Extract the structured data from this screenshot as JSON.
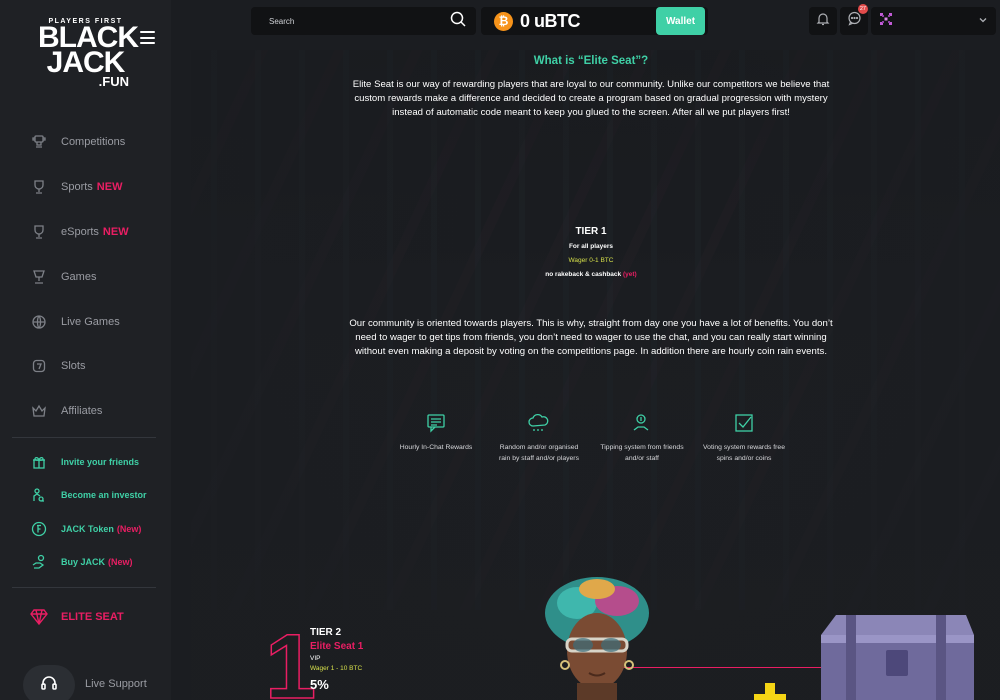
{
  "sidebar": {
    "logo": {
      "tagline": "PLAYERS FIRST",
      "line1": "BLACK",
      "line2": "JACK",
      "line3": ".FUN"
    },
    "nav": [
      {
        "label": "Competitions",
        "new": ""
      },
      {
        "label": "Sports",
        "new": "NEW"
      },
      {
        "label": "eSports",
        "new": "NEW"
      },
      {
        "label": "Games",
        "new": ""
      },
      {
        "label": "Live Games",
        "new": ""
      },
      {
        "label": "Slots",
        "new": ""
      },
      {
        "label": "Affiliates",
        "new": ""
      }
    ],
    "promo": [
      {
        "label": "Invite your friends",
        "new": ""
      },
      {
        "label": "Become an investor",
        "new": ""
      },
      {
        "label": "JACK Token",
        "new": "(New)"
      },
      {
        "label": "Buy JACK",
        "new": "(New)"
      }
    ],
    "elite_label": "ELITE SEAT",
    "support_label": "Live Support"
  },
  "header": {
    "search_placeholder": "Search",
    "balance": "0 uBTC",
    "wallet_label": "Wallet",
    "chat_badge": "27"
  },
  "main": {
    "title": "What is “Elite Seat”?",
    "intro": "Elite Seat is our way of rewarding players that are loyal to our community. Unlike our competitors we believe that custom rewards make a difference and decided to create a program based on gradual progression with mystery instead of automatic code meant to keep you glued to the screen. After all we put players first!",
    "tier1": {
      "title": "TIER 1",
      "for": "For all players",
      "wager": "Wager 0-1 BTC",
      "rake": "no rakeback & cashback",
      "rake_note": "(yet)"
    },
    "community": "Our community is oriented towards players. This is why, straight from day one you have a lot of benefits. You don’t need to wager to get tips from friends, you don’t need to wager to use the chat, and you can really start winning without even making a deposit by voting on the competitions page. In addition there are hourly coin rain events.",
    "features": [
      {
        "label": "Hourly In-Chat Rewards",
        "icon": "chat-icon"
      },
      {
        "label": "Random and/or organised rain by staff and/or players",
        "icon": "cloud-rain-icon"
      },
      {
        "label": "Tipping system from friends and/or staff",
        "icon": "tip-hand-icon"
      },
      {
        "label": "Voting system rewards free spins and/or coins",
        "icon": "checkbox-icon"
      }
    ],
    "tier2": {
      "number": "1",
      "title": "TIER 2",
      "name": "Elite Seat 1",
      "vip": "VIP",
      "wager": "Wager 1 - 10 BTC",
      "percent": "5%",
      "more": "..."
    }
  },
  "colors": {
    "accent": "#3fd0a6",
    "pink": "#e91e63",
    "yellow": "#d6e04a",
    "btc": "#f7931a"
  }
}
